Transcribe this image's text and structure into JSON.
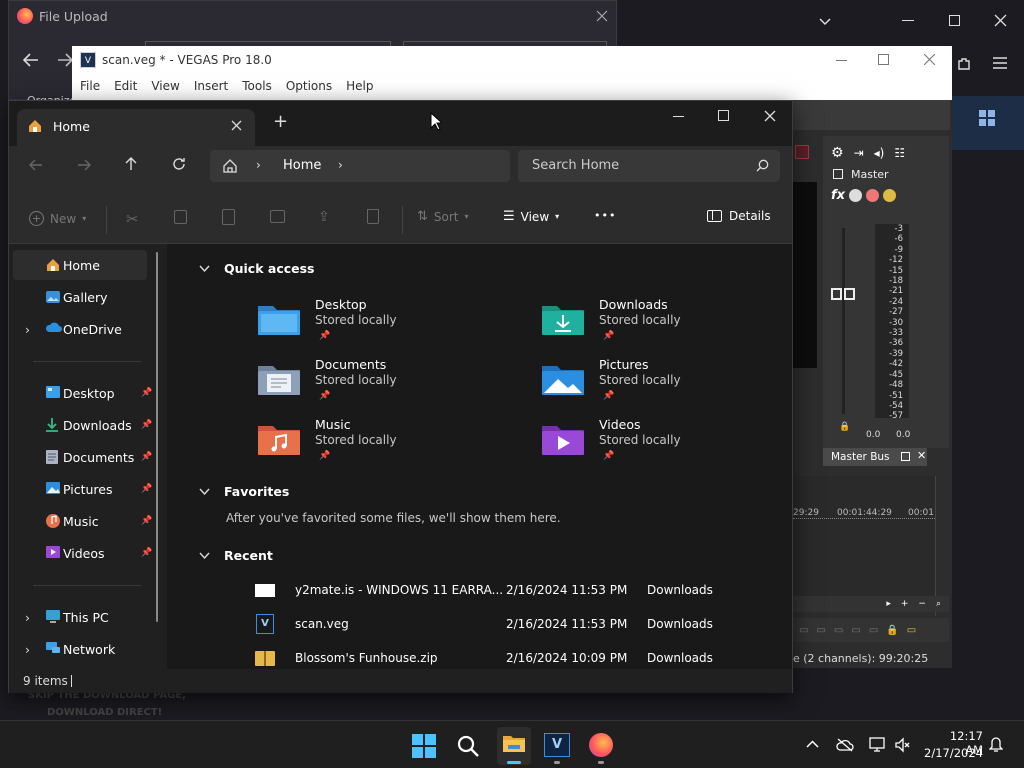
{
  "background": {
    "file_upload_title": "File Upload",
    "vegas_title": "scan.veg * - VEGAS Pro 18.0",
    "vegas_menu": [
      "File",
      "Edit",
      "View",
      "Insert",
      "Tools",
      "Options",
      "Help"
    ],
    "organize_partial": "Organize",
    "master_label": "Master",
    "master_bus_label": "Master Bus",
    "meter_ticks": [
      "-3",
      "-6",
      "-9",
      "-12",
      "-15",
      "-18",
      "-21",
      "-24",
      "-27",
      "-30",
      "-33",
      "-36",
      "-39",
      "-42",
      "-45",
      "-48",
      "-51",
      "-54",
      "-57"
    ],
    "meter_values": [
      "0.0",
      "0.0"
    ],
    "timeline_time_1": "29:29",
    "timeline_time_2": "00:01:44:29",
    "timeline_time_3": "00:01",
    "channels_status": "e (2 channels): 99:20:25",
    "page_text_1": "SKIP THE DOWNLOAD PAGE,",
    "page_text_2": "DOWNLOAD DIRECT!"
  },
  "explorer": {
    "tab_title": "Home",
    "new_tab_symbol": "+",
    "breadcrumb": "Home",
    "search_placeholder": "Search Home",
    "toolbar": {
      "new": "New",
      "sort": "Sort",
      "view": "View",
      "more": "•••",
      "details": "Details"
    },
    "sidebar": {
      "top": [
        {
          "label": "Home",
          "icon": "home-icon"
        },
        {
          "label": "Gallery",
          "icon": "gallery-icon"
        },
        {
          "label": "OneDrive",
          "icon": "cloud-icon"
        }
      ],
      "pinned": [
        {
          "label": "Desktop",
          "icon": "desktop-icon"
        },
        {
          "label": "Downloads",
          "icon": "download-icon"
        },
        {
          "label": "Documents",
          "icon": "document-icon"
        },
        {
          "label": "Pictures",
          "icon": "pictures-icon"
        },
        {
          "label": "Music",
          "icon": "music-icon"
        },
        {
          "label": "Videos",
          "icon": "video-icon"
        }
      ],
      "bottom": [
        {
          "label": "This PC",
          "icon": "pc-icon"
        },
        {
          "label": "Network",
          "icon": "network-icon"
        }
      ]
    },
    "sections": {
      "quick_access": "Quick access",
      "favorites": "Favorites",
      "favorites_empty": "After you've favorited some files, we'll show them here.",
      "recent": "Recent"
    },
    "quick_access": [
      {
        "name": "Desktop",
        "status": "Stored locally",
        "color": "#3aa0e8"
      },
      {
        "name": "Downloads",
        "status": "Stored locally",
        "color": "#1fb0a0"
      },
      {
        "name": "Documents",
        "status": "Stored locally",
        "color": "#8da0b8"
      },
      {
        "name": "Pictures",
        "status": "Stored locally",
        "color": "#2c8ee0"
      },
      {
        "name": "Music",
        "status": "Stored locally",
        "color": "#e8704a"
      },
      {
        "name": "Videos",
        "status": "Stored locally",
        "color": "#9a48d8"
      }
    ],
    "recent": [
      {
        "name": "y2mate.is - WINDOWS 11 EARRA...",
        "date": "2/16/2024 11:53 PM",
        "location": "Downloads"
      },
      {
        "name": "scan.veg",
        "date": "2/16/2024 11:53 PM",
        "location": "Downloads"
      },
      {
        "name": "Blossom's Funhouse.zip",
        "date": "2/16/2024 10:09 PM",
        "location": "Downloads"
      }
    ],
    "status": "9 items"
  },
  "taskbar": {
    "time": "12:17 AM",
    "date": "2/17/2024"
  },
  "colors": {
    "accent": "#4cc2ff",
    "explorer_bg": "#202020",
    "taskbar_bg": "#1f1f1f"
  }
}
